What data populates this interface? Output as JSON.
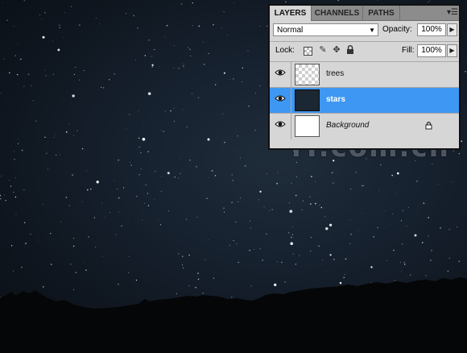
{
  "panel": {
    "tabs": [
      {
        "label": "LAYERS",
        "active": true
      },
      {
        "label": "CHANNELS",
        "active": false
      },
      {
        "label": "PATHS",
        "active": false
      }
    ],
    "menu_icon": "panel-menu-icon",
    "blend_mode": "Normal",
    "opacity_label": "Opacity:",
    "opacity_value": "100%",
    "lock_label": "Lock:",
    "lock_icons": [
      "lock-transparent-icon",
      "lock-paint-brush-icon",
      "lock-move-icon",
      "lock-all-icon"
    ],
    "fill_label": "Fill:",
    "fill_value": "100%",
    "layers": [
      {
        "name": "trees",
        "selected": false,
        "thumbnail": "transparent",
        "locked": false
      },
      {
        "name": "stars",
        "selected": true,
        "thumbnail": "dark",
        "locked": false
      },
      {
        "name": "Background",
        "selected": false,
        "thumbnail": "white",
        "locked": true
      }
    ]
  },
  "watermark": "iT.com.cn",
  "colors": {
    "selected_layer": "#3e97f2",
    "panel_bg": "#d6d6d6",
    "sky_dark": "#0d1218"
  }
}
